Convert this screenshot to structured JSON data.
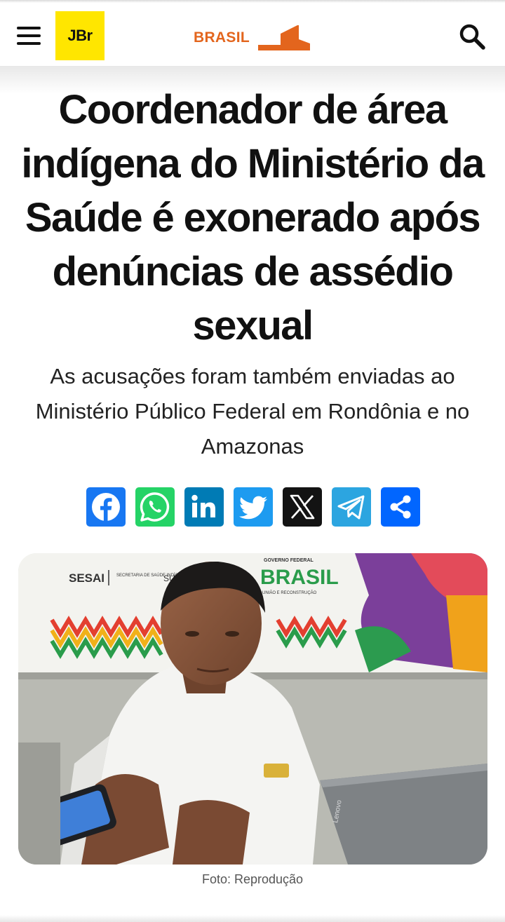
{
  "header": {
    "logo_text": "JBr",
    "section_label": "BRASIL",
    "menu_icon": "hamburger-menu-icon",
    "search_icon": "search-icon"
  },
  "article": {
    "headline": "Coordenador de área indígena do Ministério da Saúde é exonerado após denúncias de assédio sexual",
    "subtitle": "As acusações foram também enviadas ao Ministério Público Federal em Rondônia e no Amazonas",
    "photo_caption": "Foto: Reprodução"
  },
  "photo_signage": {
    "sesai": "SESAI",
    "sesai_sub": "SECRETARIA DE SAÚDE INDÍGENA",
    "sus": "SUS",
    "gov_top": "GOVERNO FEDERAL",
    "gov_brand": "BRASIL",
    "gov_bottom": "UNIÃO E RECONSTRUÇÃO",
    "laptop_brand": "Lenovo"
  },
  "share": [
    {
      "network": "Facebook",
      "icon": "facebook-icon",
      "color": "#1877f2"
    },
    {
      "network": "WhatsApp",
      "icon": "whatsapp-icon",
      "color": "#25d366"
    },
    {
      "network": "LinkedIn",
      "icon": "linkedin-icon",
      "color": "#007bb5"
    },
    {
      "network": "Twitter",
      "icon": "twitter-bird-icon",
      "color": "#1d9bf0"
    },
    {
      "network": "X",
      "icon": "x-icon",
      "color": "#131313"
    },
    {
      "network": "Telegram",
      "icon": "telegram-icon",
      "color": "#2ca5e0"
    },
    {
      "network": "Share",
      "icon": "share-icon",
      "color": "#0166ff"
    }
  ],
  "colors": {
    "logo_bg": "#ffe600",
    "section_accent": "#e3651d"
  }
}
